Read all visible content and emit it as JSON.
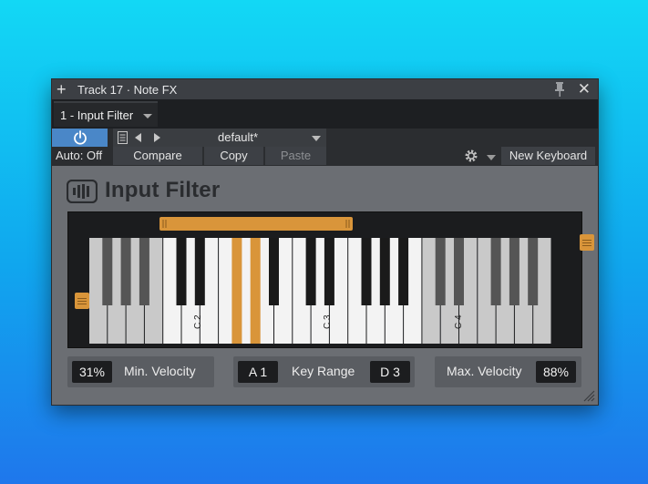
{
  "window": {
    "title": "Track 17 · Note FX",
    "tab_label": "1 - Input Filter"
  },
  "preset": {
    "name": "default*"
  },
  "toolbar": {
    "auto_label": "Auto: Off",
    "compare_label": "Compare",
    "copy_label": "Copy",
    "paste_label": "Paste",
    "new_keyboard_label": "New Keyboard"
  },
  "plugin": {
    "title": "Input Filter"
  },
  "keyboard": {
    "octave_labels": [
      "C 2",
      "C 3",
      "C 4"
    ],
    "key_range": {
      "low": "A 1",
      "high": "D 3"
    },
    "highlighted_keys": [
      "F#2",
      "G#2"
    ],
    "accent_color": "#d9953a"
  },
  "controls": {
    "min_velocity_value": "31%",
    "min_velocity_label": "Min. Velocity",
    "key_range_label": "Key Range",
    "max_velocity_label": "Max. Velocity",
    "max_velocity_value": "88%"
  },
  "icons": {
    "power": "power-icon",
    "preset_list": "document-icon",
    "settings": "gear-icon",
    "close": "close-icon",
    "pin": "pin-icon"
  }
}
